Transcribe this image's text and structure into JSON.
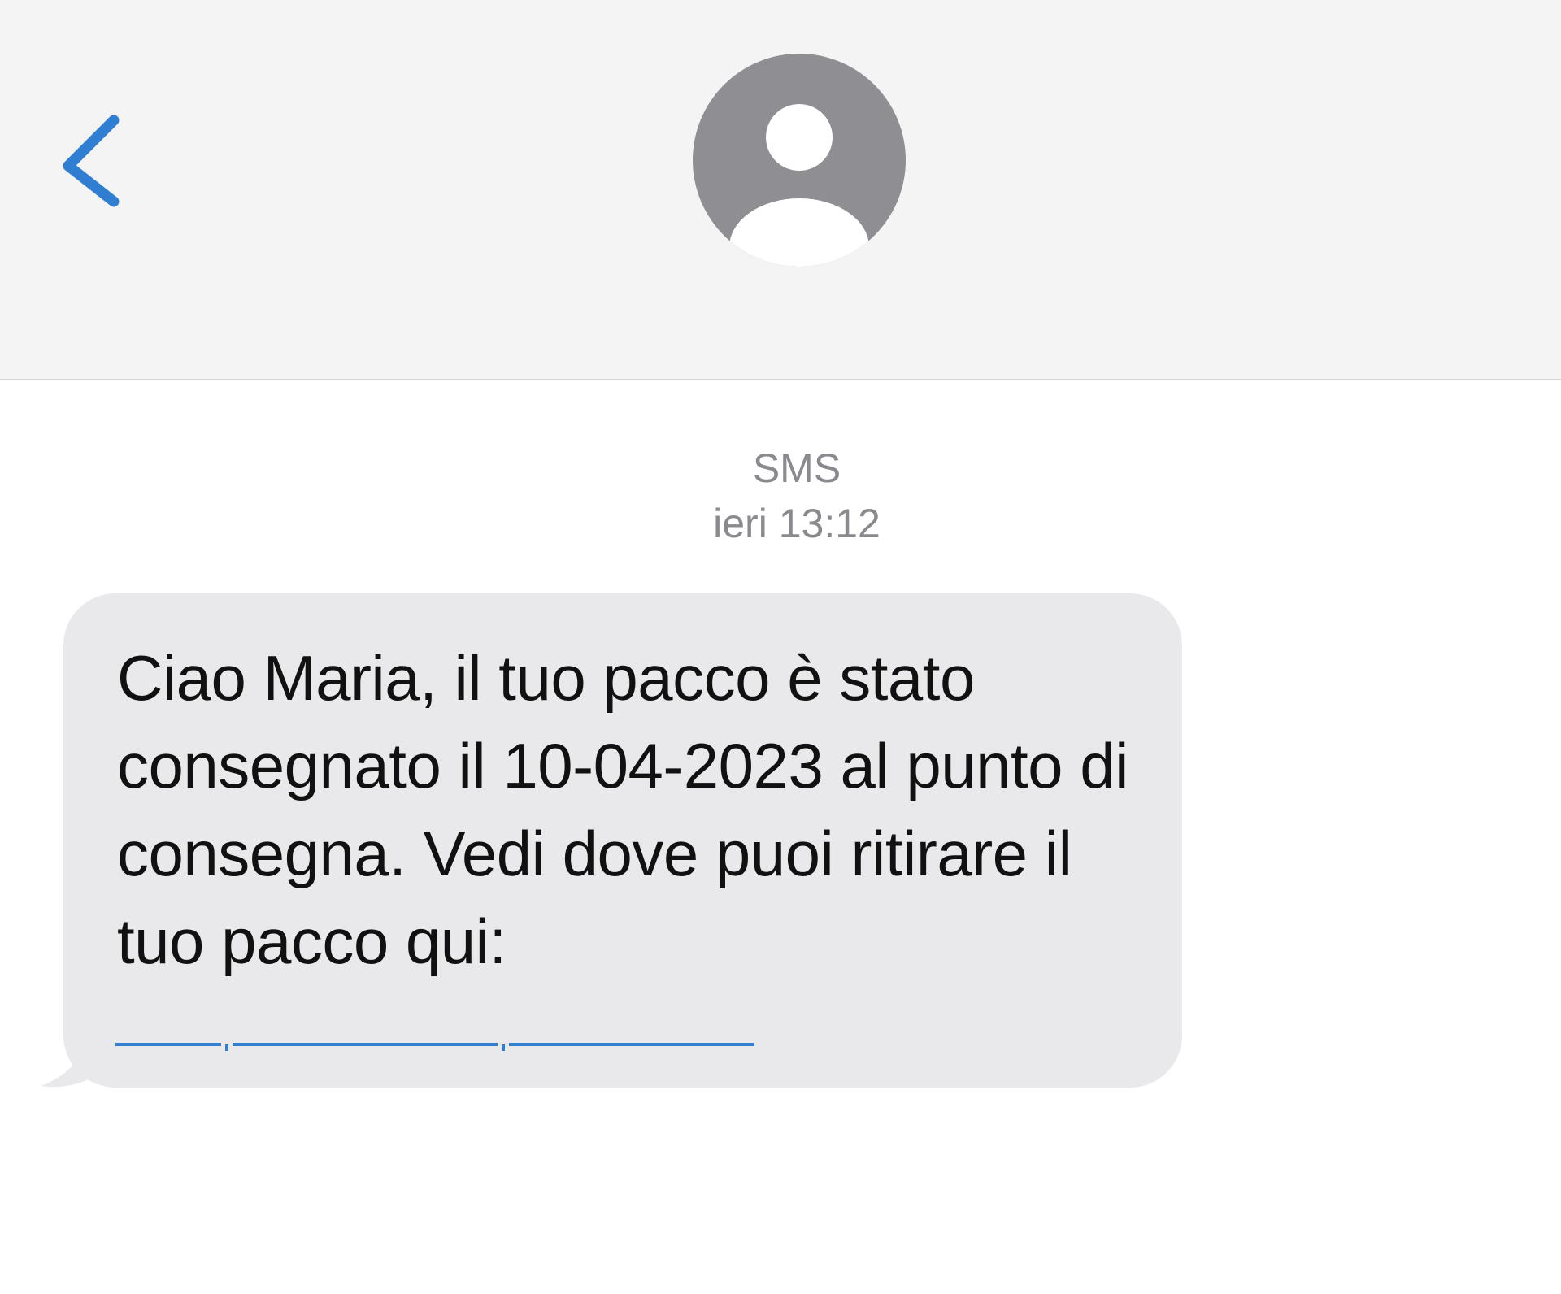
{
  "header": {
    "back_icon": "chevron-left-icon",
    "avatar_icon": "person-circle-icon"
  },
  "thread": {
    "service_label": "SMS",
    "timestamp": "ieri 13:12"
  },
  "message": {
    "text": "Ciao Maria, il tuo pacco è stato consegnato il 10-04-2023 al punto di consegna. Vedi dove puoi ritirare il tuo pacco qui:",
    "link_redacted": true
  },
  "colors": {
    "accent": "#2f7ed1",
    "nav_background": "#f4f4f4",
    "bubble_background": "#e9e9eb",
    "avatar_gray": "#8e8e93",
    "meta_text": "#8a8a8e"
  }
}
